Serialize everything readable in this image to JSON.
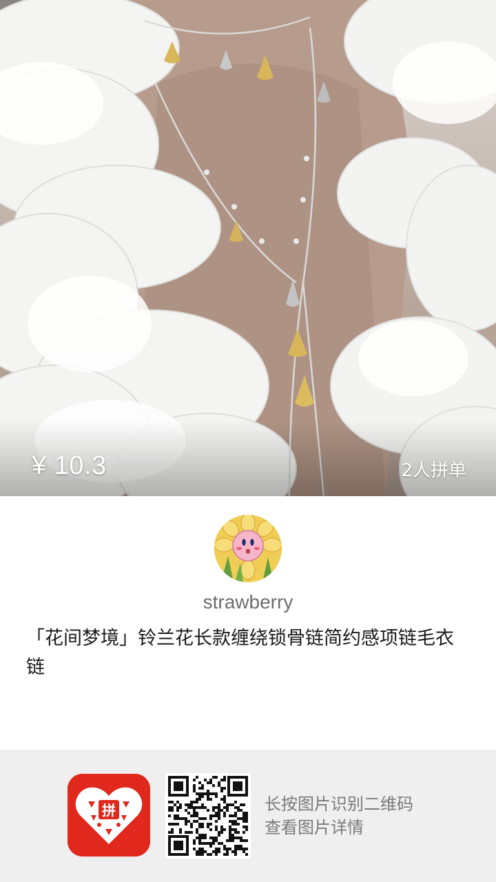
{
  "product": {
    "price": "¥ 10.3",
    "group_count": "2人拼单",
    "title": "「花间梦境」铃兰花长款缠绕锁骨链简约感项链毛衣链"
  },
  "seller": {
    "name": "strawberry"
  },
  "footer": {
    "hint_line1": "长按图片识别二维码",
    "hint_line2": "查看图片详情",
    "app_logo_text": "拼"
  },
  "icons": {
    "app_logo": "pinduoduo-logo-icon",
    "qr": "qr-code-icon",
    "avatar": "kirby-flower-avatar"
  },
  "colors": {
    "brand_red": "#e0281d",
    "footer_bg": "#efefef",
    "title_text": "#1a1a1a",
    "seller_text": "#6d6d6d",
    "hint_text": "#7a7a7a"
  }
}
